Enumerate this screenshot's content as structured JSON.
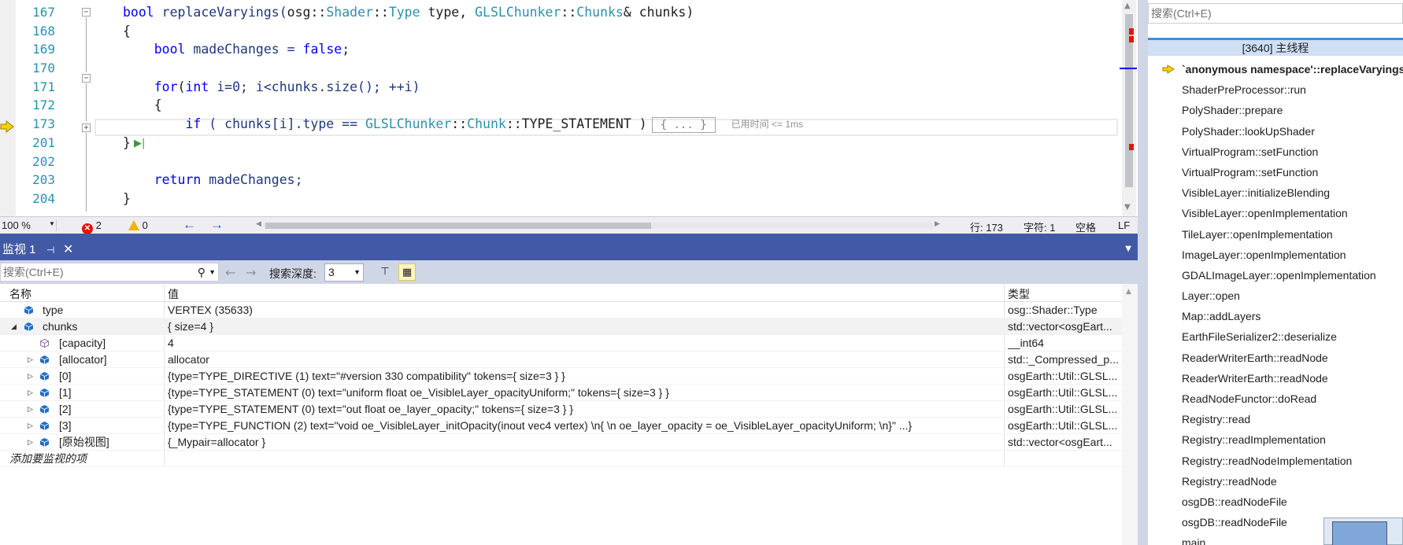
{
  "editor": {
    "line_numbers": [
      "167",
      "168",
      "169",
      "170",
      "171",
      "172",
      "173",
      "201",
      "202",
      "203",
      "204"
    ],
    "lines": {
      "l167": {
        "kw": "bool",
        "fn": " replaceVaryings(",
        "ns1": "osg",
        "sep1": "::",
        "t1": "Shader",
        "sep2": "::",
        "t2": "Type",
        "arg1": " type, ",
        "ns2": "GLSLChunker",
        "sep3": "::",
        "t3": "Chunks",
        "arg2": "& chunks)"
      },
      "l168": "{",
      "l169": {
        "kw": "bool",
        "rest1": " madeChanges = ",
        "kw2": "false",
        "rest2": ";"
      },
      "l171": {
        "kw": "for",
        "p1": "(",
        "kw2": "int",
        "rest": " i=0; i<chunks.size(); ++i)"
      },
      "l172": "{",
      "l173": {
        "kw": "if",
        "p1": " ( chunks[i].type == ",
        "t1": "GLSLChunker",
        "sep1": "::",
        "t2": "Chunk",
        "sep2": "::",
        "rest": "TYPE_STATEMENT )",
        "collapsed": "{ ... }",
        "elapsed": "已用时间 <= 1ms"
      },
      "l201": "}",
      "l203": {
        "kw": "return",
        "rest": " madeChanges;"
      },
      "l204": "}"
    }
  },
  "status_bar": {
    "zoom": "100 %",
    "errors": "2",
    "warnings": "0",
    "line": "行: 173",
    "char": "字符: 1",
    "whitespace": "空格",
    "eol": "LF"
  },
  "watch": {
    "tab_label": "监视 1",
    "search_placeholder": "搜索(Ctrl+E)",
    "depth_label": "搜索深度:",
    "depth_value": "3",
    "columns": {
      "name": "名称",
      "value": "值",
      "type": "类型"
    },
    "rows": [
      {
        "name": "type",
        "value": "VERTEX (35633)",
        "type": "osg::Shader::Type"
      },
      {
        "name": "chunks",
        "value": "{ size=4 }",
        "type": "std::vector<osgEart..."
      },
      {
        "name": "[capacity]",
        "value": "4",
        "type": "__int64"
      },
      {
        "name": "[allocator]",
        "value": "allocator",
        "type": "std::_Compressed_p..."
      },
      {
        "name": "[0]",
        "value": "{type=TYPE_DIRECTIVE (1) text=\"#version 330 compatibility\" tokens={ size=3 } }",
        "type": "osgEarth::Util::GLSL..."
      },
      {
        "name": "[1]",
        "value": "{type=TYPE_STATEMENT (0) text=\"uniform float oe_VisibleLayer_opacityUniform;\" tokens={ size=3 } }",
        "type": "osgEarth::Util::GLSL..."
      },
      {
        "name": "[2]",
        "value": "{type=TYPE_STATEMENT (0) text=\"out float oe_layer_opacity;\" tokens={ size=3 } }",
        "type": "osgEarth::Util::GLSL..."
      },
      {
        "name": "[3]",
        "value": "{type=TYPE_FUNCTION (2) text=\"void oe_VisibleLayer_initOpacity(inout vec4 vertex) \\n{ \\n    oe_layer_opacity = oe_VisibleLayer_opacityUniform; \\n}\" ...}",
        "type": "osgEarth::Util::GLSL..."
      },
      {
        "name": "[原始视图]",
        "value": "{_Mypair=allocator }",
        "type": "std::vector<osgEart..."
      }
    ],
    "add_item": "添加要监视的项"
  },
  "callstack": {
    "search_placeholder": "搜索(Ctrl+E)",
    "thread": "[3640] 主线程",
    "frames": [
      "`anonymous namespace'::replaceVaryings",
      "ShaderPreProcessor::run",
      "PolyShader::prepare",
      "PolyShader::lookUpShader",
      "VirtualProgram::setFunction",
      "VirtualProgram::setFunction",
      "VisibleLayer::initializeBlending",
      "VisibleLayer::openImplementation",
      "TileLayer::openImplementation",
      "ImageLayer::openImplementation",
      "GDALImageLayer::openImplementation",
      "Layer::open",
      "Map::addLayers",
      "EarthFileSerializer2::deserialize",
      "ReaderWriterEarth::readNode",
      "ReaderWriterEarth::readNode",
      "ReadNodeFunctor::doRead",
      "Registry::read",
      "Registry::readImplementation",
      "Registry::readNodeImplementation",
      "Registry::readNode",
      "osgDB::readNodeFile",
      "osgDB::readNodeFile",
      "main"
    ]
  },
  "colors": {
    "keyword": "#0000ff",
    "type": "#2b91af",
    "tab_bar": "#425aa5",
    "toolbar": "#cfd6e5",
    "error": "#e51400",
    "warning": "#f0b400"
  }
}
